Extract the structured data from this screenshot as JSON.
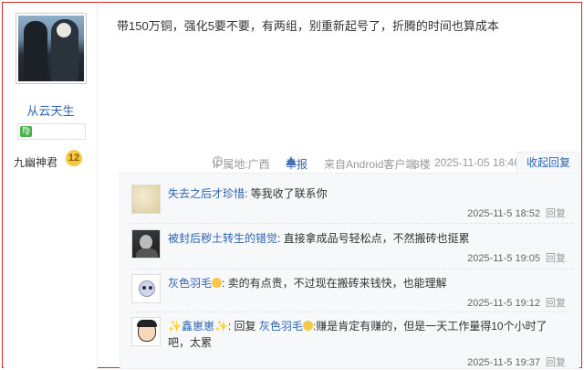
{
  "author": {
    "username": "从云天生",
    "zodiac_icon": "virgo-icon",
    "forum_name": "九幽神君",
    "level": "12"
  },
  "post": {
    "content": "带150万铜，强化5要不要，有两组，别重新起号了，折腾的时间也算成本",
    "ip_label": "IP属地:广西",
    "report_label": "举报",
    "client_label": "来自Android客户端",
    "floor": "3楼",
    "time": "2025-11-05 18:46",
    "collapse_label": "收起回复"
  },
  "comments": [
    {
      "user": "失去之后才珍惜",
      "text": ": 等我收了联系你",
      "time": "2025-11-5 18:52",
      "reply_label": "回复"
    },
    {
      "user": "被封后秽土转生的错觉",
      "text": ": 直接拿成品号轻松点，不然搬砖也挺累",
      "time": "2025-11-5 19:05",
      "reply_label": "回复"
    },
    {
      "user": "灰色羽毛",
      "text": ": 卖的有点贵，不过现在搬砖来钱快，也能理解",
      "time": "2025-11-5 19:12",
      "reply_label": "回复"
    },
    {
      "user": "✨鑫崽崽✨",
      "reply_word": ": 回复",
      "reply_to": "灰色羽毛",
      "text_line1": ":赚是肯定有赚的，但是一天工作量得10个小时了",
      "text_line2": "吧，太累",
      "time": "2025-11-5 19:37",
      "reply_label": "回复"
    }
  ],
  "colors": {
    "link": "#2d64b3",
    "frame": "#e02424",
    "comment_bg": "#f7f8fa"
  }
}
